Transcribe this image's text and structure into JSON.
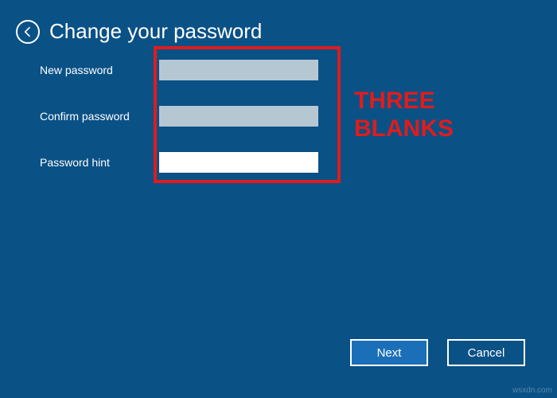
{
  "header": {
    "title": "Change your password"
  },
  "form": {
    "fields": [
      {
        "label": "New password",
        "value": ""
      },
      {
        "label": "Confirm password",
        "value": ""
      },
      {
        "label": "Password hint",
        "value": ""
      }
    ]
  },
  "annotation": {
    "line1": "THREE",
    "line2": "BLANKS"
  },
  "buttons": {
    "next": "Next",
    "cancel": "Cancel"
  },
  "watermark": "wsxdn.com"
}
